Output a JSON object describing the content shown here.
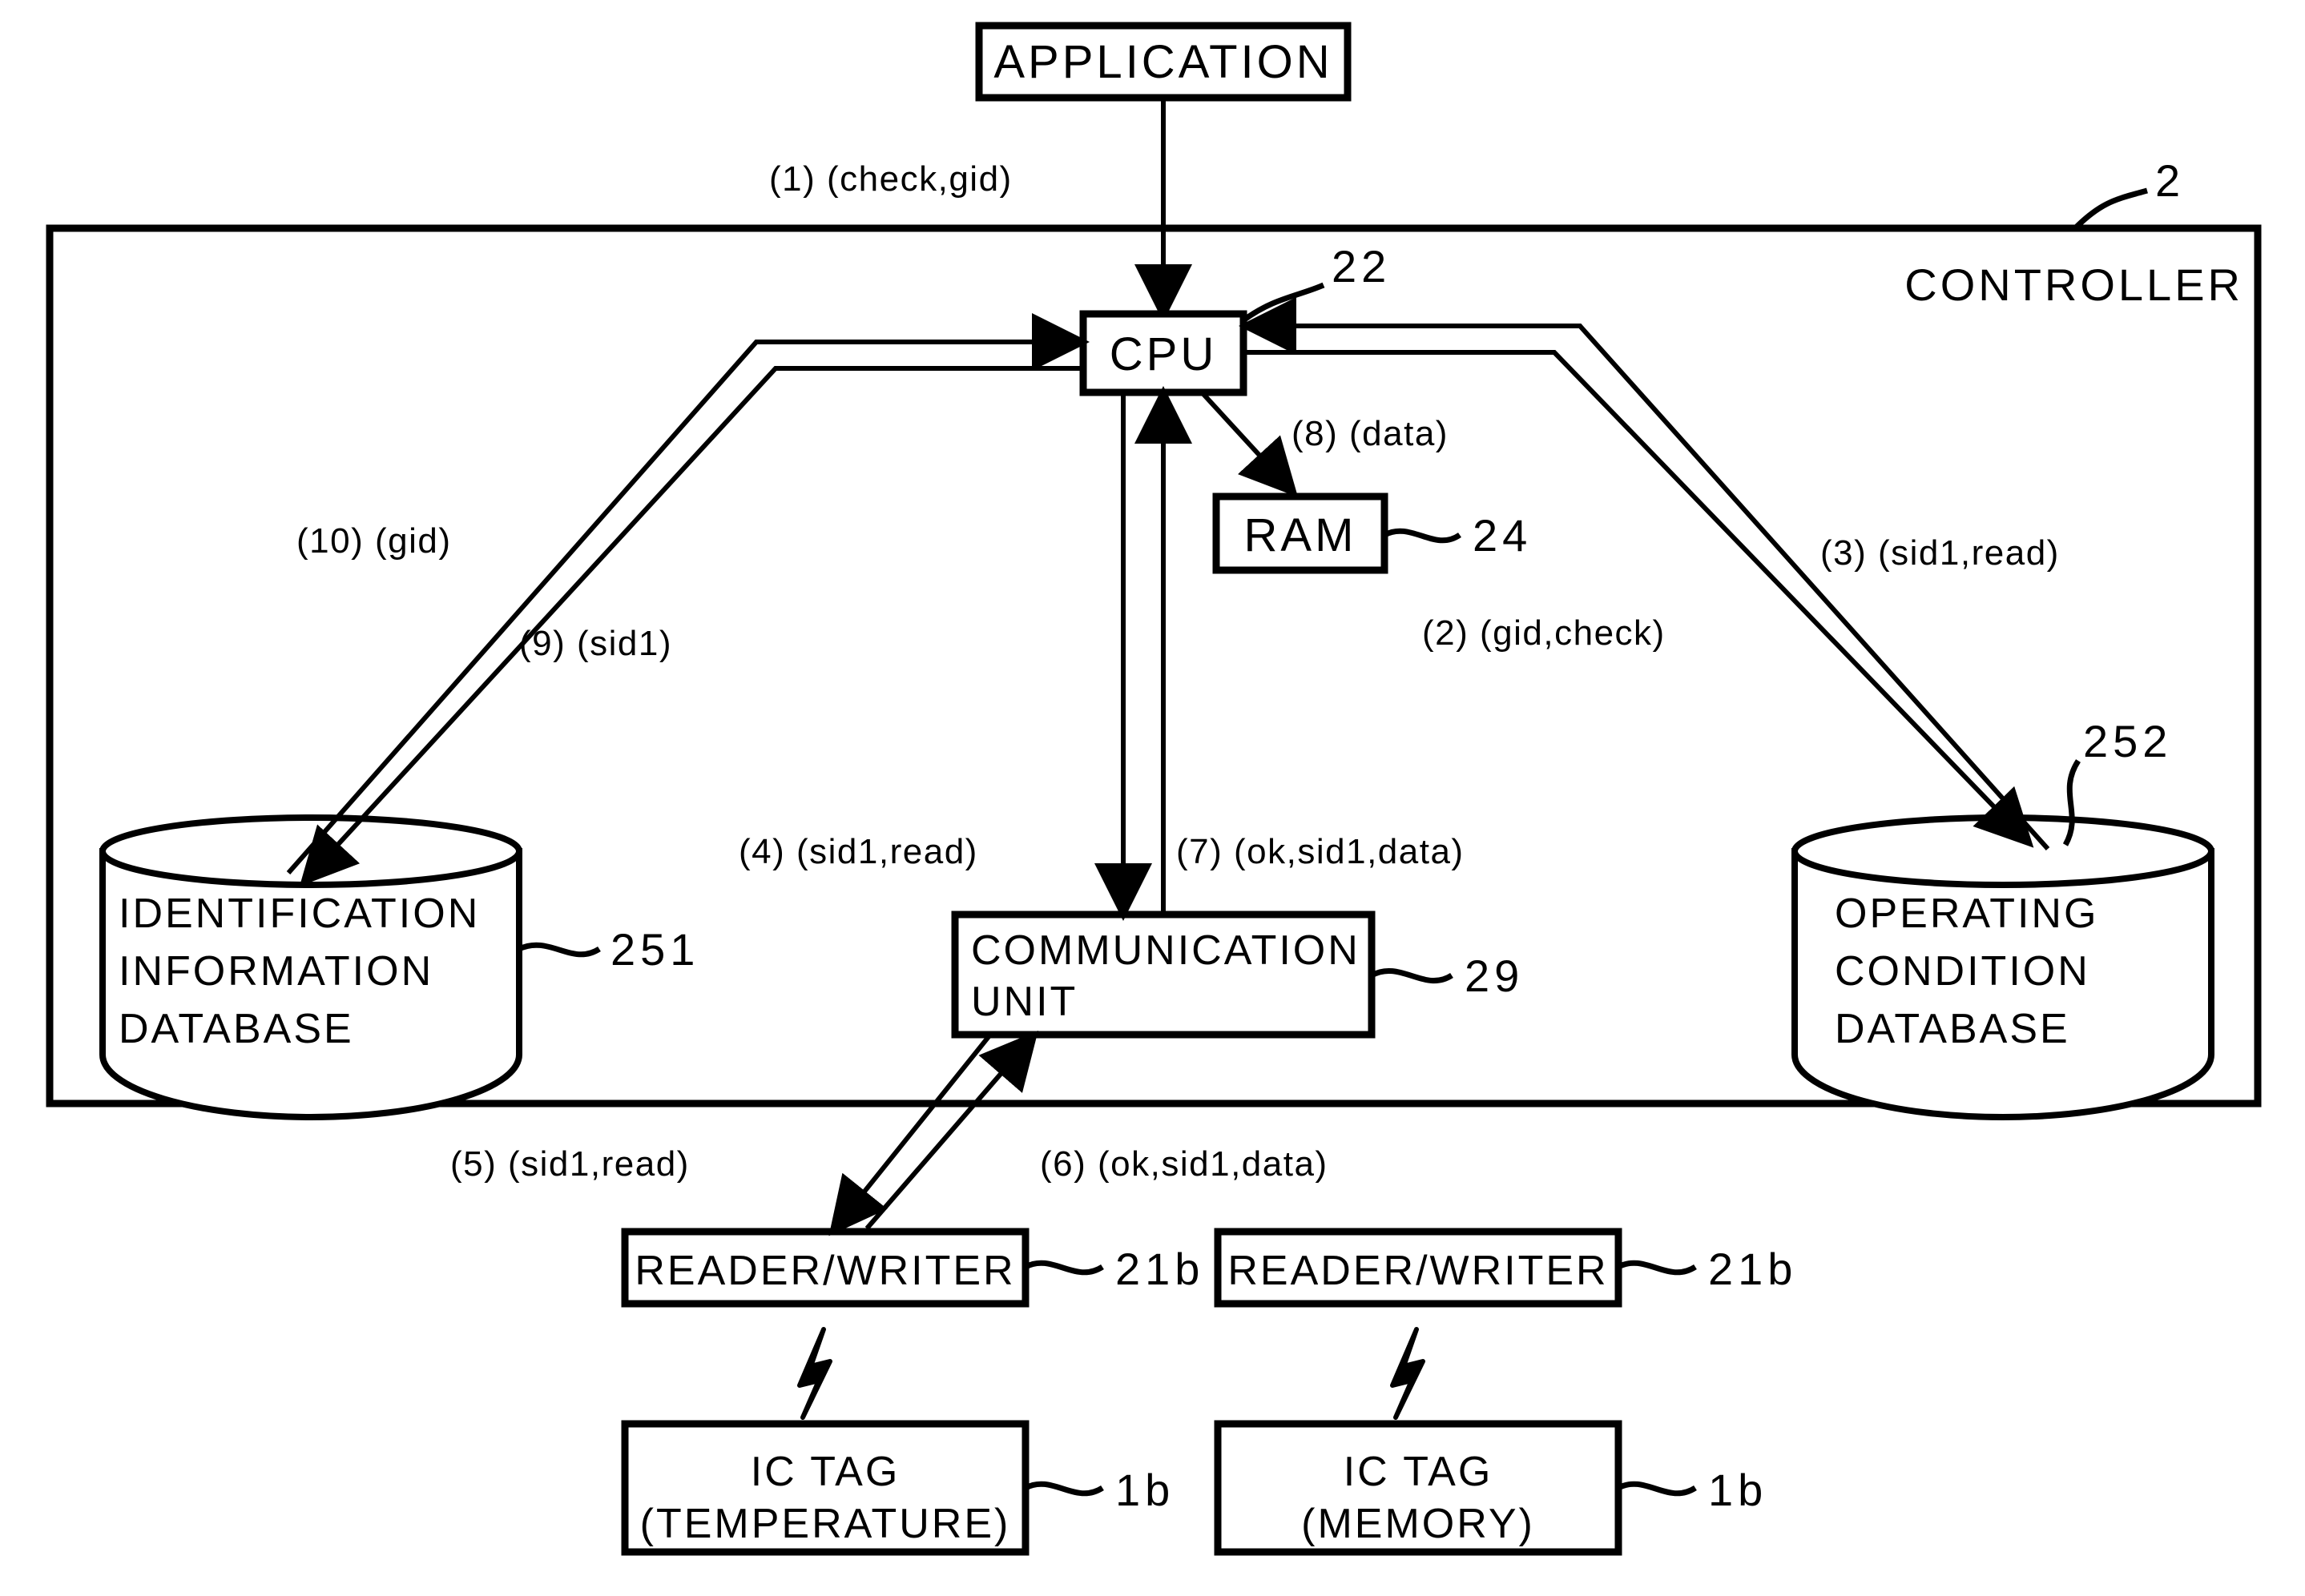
{
  "figure": {
    "controller": {
      "label": "CONTROLLER",
      "ref": "2"
    },
    "boxes": {
      "application": {
        "label": "APPLICATION"
      },
      "cpu": {
        "label": "CPU",
        "ref": "22"
      },
      "ram": {
        "label": "RAM",
        "ref": "24"
      },
      "communication_unit": {
        "line1": "COMMUNICATION",
        "line2": "UNIT",
        "ref": "29"
      },
      "identification_db": {
        "line1": "IDENTIFICATION",
        "line2": "INFORMATION",
        "line3": "DATABASE",
        "ref": "251"
      },
      "operating_db": {
        "line1": "OPERATING",
        "line2": "CONDITION",
        "line3": "DATABASE",
        "ref": "252"
      },
      "reader_writer_left": {
        "label": "READER/WRITER",
        "ref": "21b"
      },
      "reader_writer_right": {
        "label": "READER/WRITER",
        "ref": "21b"
      },
      "ic_tag_temperature": {
        "line1": "IC TAG",
        "line2": "(TEMPERATURE)",
        "ref": "1b"
      },
      "ic_tag_memory": {
        "line1": "IC TAG",
        "line2": "(MEMORY)",
        "ref": "1b"
      }
    },
    "flow_labels": {
      "step1": "(1) (check,gid)",
      "step2": "(2) (gid,check)",
      "step3": "(3) (sid1,read)",
      "step4": "(4) (sid1,read)",
      "step5": "(5) (sid1,read)",
      "step6": "(6) (ok,sid1,data)",
      "step7": "(7) (ok,sid1,data)",
      "step8": "(8) (data)",
      "step9": "(9) (sid1)",
      "step10": "(10) (gid)"
    },
    "icons": {
      "rf_link_left": "lightning-bolt-icon",
      "rf_link_right": "lightning-bolt-icon"
    },
    "colors": {
      "stroke": "#000000",
      "background": "#ffffff"
    }
  }
}
